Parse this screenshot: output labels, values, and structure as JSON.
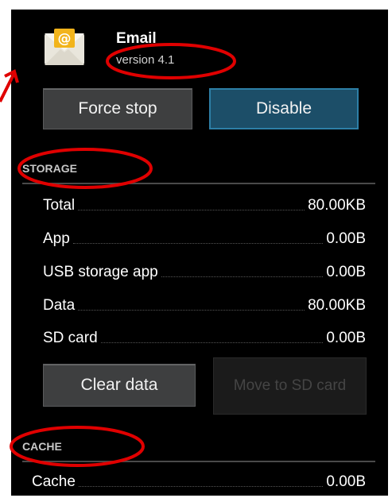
{
  "app": {
    "name": "Email",
    "version": "version 4.1",
    "icon": "email-envelope-icon",
    "icon_glyph": "@"
  },
  "actions": {
    "force_stop_label": "Force stop",
    "disable_label": "Disable"
  },
  "storage": {
    "header": "STORAGE",
    "rows": [
      {
        "label": "Total",
        "value": "80.00KB"
      },
      {
        "label": "App",
        "value": "0.00B"
      },
      {
        "label": "USB storage app",
        "value": "0.00B"
      },
      {
        "label": "Data",
        "value": "80.00KB"
      },
      {
        "label": "SD card",
        "value": "0.00B"
      }
    ],
    "clear_data_label": "Clear data",
    "move_to_sd_label": "Move to SD card"
  },
  "cache": {
    "header": "CACHE",
    "rows": [
      {
        "label": "Cache",
        "value": "0.00B"
      }
    ]
  },
  "colors": {
    "background": "#000000",
    "accent_blue": "#1c4e68",
    "annotation_red": "#e00000"
  }
}
